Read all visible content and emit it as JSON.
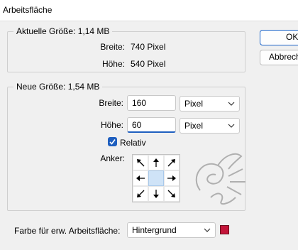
{
  "window": {
    "title": "Arbeitsfläche"
  },
  "buttons": {
    "ok": "OK",
    "cancel": "Abbrechen"
  },
  "current_size": {
    "legend": "Aktuelle Größe: 1,14 MB",
    "width_label": "Breite:",
    "width_value": "740 Pixel",
    "height_label": "Höhe:",
    "height_value": "540 Pixel"
  },
  "new_size": {
    "legend": "Neue Größe: 1,54 MB",
    "width_label": "Breite:",
    "width_value": "160",
    "width_unit": "Pixel",
    "height_label": "Höhe:",
    "height_value": "60",
    "height_unit": "Pixel",
    "relative_label": "Relativ",
    "relative_checked": true,
    "anchor_label": "Anker:"
  },
  "canvas_extension": {
    "label": "Farbe für erw. Arbeitsfläche:",
    "value": "Hintergrund",
    "color": "#c4153a"
  }
}
